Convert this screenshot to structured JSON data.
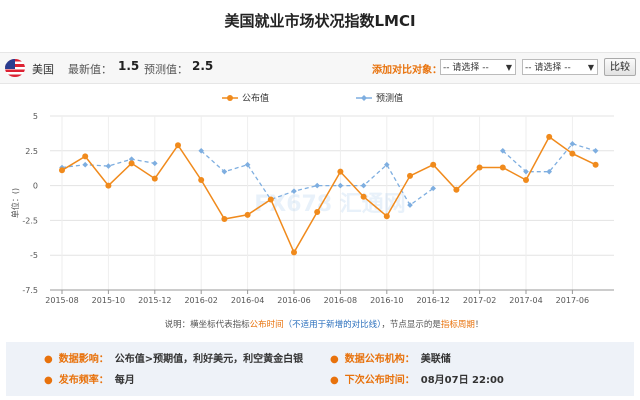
{
  "page": {
    "title": "美国就业市场状况指数LMCI"
  },
  "infobar": {
    "country": "美国",
    "latest_label": "最新值：",
    "latest_value": "1.5",
    "forecast_label": "预测值：",
    "forecast_value": "2.5",
    "compare_label": "添加对比对象：",
    "select1": "-- 请选择 --",
    "select2": "-- 请选择 --",
    "compare_button": "比较"
  },
  "chart_data": {
    "type": "line",
    "legend": [
      "公布值",
      "预测值"
    ],
    "ylabel": "单位：()",
    "ylim": [
      -7.5,
      5
    ],
    "yticks": [
      "5",
      "2.5",
      "0",
      "-2.5",
      "-5",
      "-7.5"
    ],
    "xticks": [
      "2015-08",
      "2015-10",
      "2015-12",
      "2016-02",
      "2016-04",
      "2016-06",
      "2016-08",
      "2016-10",
      "2016-12",
      "2017-02",
      "2017-04",
      "2017-06"
    ],
    "grid": true,
    "series": [
      {
        "name": "公布值",
        "color": "#f08a1c",
        "style": "solid",
        "points": [
          [
            "2015-08",
            1.1
          ],
          [
            "2015-09",
            2.1
          ],
          [
            "2015-10",
            0.0
          ],
          [
            "2015-11",
            1.6
          ],
          [
            "2015-12",
            0.5
          ],
          [
            "2016-01",
            2.9
          ],
          [
            "2016-02",
            0.4
          ],
          [
            "2016-03",
            -2.4
          ],
          [
            "2016-04",
            -2.1
          ],
          [
            "2016-05",
            -1.0
          ],
          [
            "2016-06",
            -4.8
          ],
          [
            "2016-07",
            -1.9
          ],
          [
            "2016-08",
            1.0
          ],
          [
            "2016-09",
            -0.8
          ],
          [
            "2016-10",
            -2.2
          ],
          [
            "2016-11",
            0.7
          ],
          [
            "2016-12",
            1.5
          ],
          [
            "2017-01",
            -0.3
          ],
          [
            "2017-02",
            1.3
          ],
          [
            "2017-03",
            1.3
          ],
          [
            "2017-04",
            0.4
          ],
          [
            "2017-05",
            3.5
          ],
          [
            "2017-06",
            2.3
          ],
          [
            "2017-07",
            1.5
          ]
        ]
      },
      {
        "name": "预测值",
        "color": "#7eaee0",
        "style": "dashed",
        "segments": [
          [
            [
              "2015-08",
              1.3
            ],
            [
              "2015-09",
              1.5
            ],
            [
              "2015-10",
              1.4
            ],
            [
              "2015-11",
              1.9
            ],
            [
              "2015-12",
              1.6
            ]
          ],
          [
            [
              "2016-02",
              2.5
            ],
            [
              "2016-03",
              1.0
            ],
            [
              "2016-04",
              1.5
            ],
            [
              "2016-05",
              -1.0
            ],
            [
              "2016-06",
              -0.4
            ],
            [
              "2016-07",
              0.0
            ],
            [
              "2016-08",
              0.0
            ],
            [
              "2016-09",
              0.0
            ],
            [
              "2016-10",
              1.5
            ],
            [
              "2016-11",
              -1.4
            ],
            [
              "2016-12",
              -0.2
            ]
          ],
          [
            [
              "2017-03",
              2.5
            ],
            [
              "2017-04",
              1.0
            ],
            [
              "2017-05",
              1.0
            ],
            [
              "2017-06",
              3.0
            ],
            [
              "2017-07",
              2.5
            ]
          ]
        ]
      }
    ]
  },
  "note": {
    "prefix": "说明：横坐标代表指标",
    "highlight1": "公布时间",
    "mid": "（不适用于新增的对比线）",
    "suffix": "，节点显示的是",
    "highlight2": "指标周期",
    "end": "！"
  },
  "watermark": "FX678 汇通网",
  "footer": {
    "impact_label": "数据影响：",
    "impact_value": "公布值>预期值，利好美元，利空黄金白银",
    "agency_label": "数据公布机构：",
    "agency_value": "美联储",
    "frequency_label": "发布频率：",
    "frequency_value": "每月",
    "next_label": "下次公布时间：",
    "next_value": "08月07日 22:00"
  }
}
